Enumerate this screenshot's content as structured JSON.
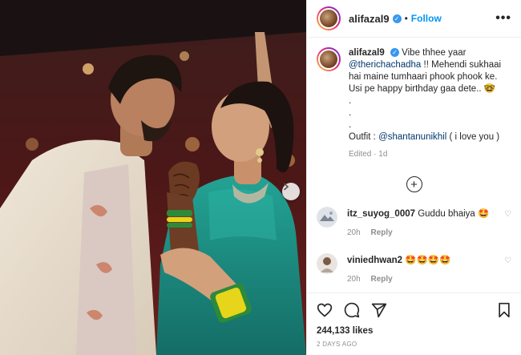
{
  "post": {
    "username": "alifazal9",
    "follow_label": "Follow",
    "separator": "•",
    "more_label": "•••"
  },
  "caption": {
    "username": "alifazal9",
    "text_1": "Vibe thhee yaar",
    "mention_1": "@therichachadha",
    "text_2": "!! Mehendi sukhaai hai maine tumhaari phook phook ke. Usi pe happy birthday gaa dete.. 🤓",
    "dots": [
      ".",
      ".",
      "."
    ],
    "outfit_label": "Outfit :",
    "mention_2": "@shantanunikhil",
    "text_3": "( i love you )",
    "edited": "Edited",
    "edited_sep": "·",
    "edited_time": "1d"
  },
  "load_more_icon": "plus-circle-icon",
  "comments": [
    {
      "username": "itz_suyog_0007",
      "text": "Guddu bhaiya 🤩",
      "time": "20h",
      "reply": "Reply"
    },
    {
      "username": "viniedhwan2",
      "text": "🤩🤩🤩🤩",
      "time": "20h",
      "reply": "Reply"
    }
  ],
  "actions": {
    "icons": [
      "heart-icon",
      "comment-icon",
      "share-icon",
      "bookmark-icon"
    ]
  },
  "likes": "244,133 likes",
  "posted": "2 DAYS AGO",
  "colors": {
    "follow_blue": "#0095f6",
    "verified_blue": "#3897f0",
    "mention_blue": "#00376b",
    "dress_teal": "#1f8c82",
    "bangle_yellow": "#e6d51a",
    "muted": "#8e8e8e"
  }
}
